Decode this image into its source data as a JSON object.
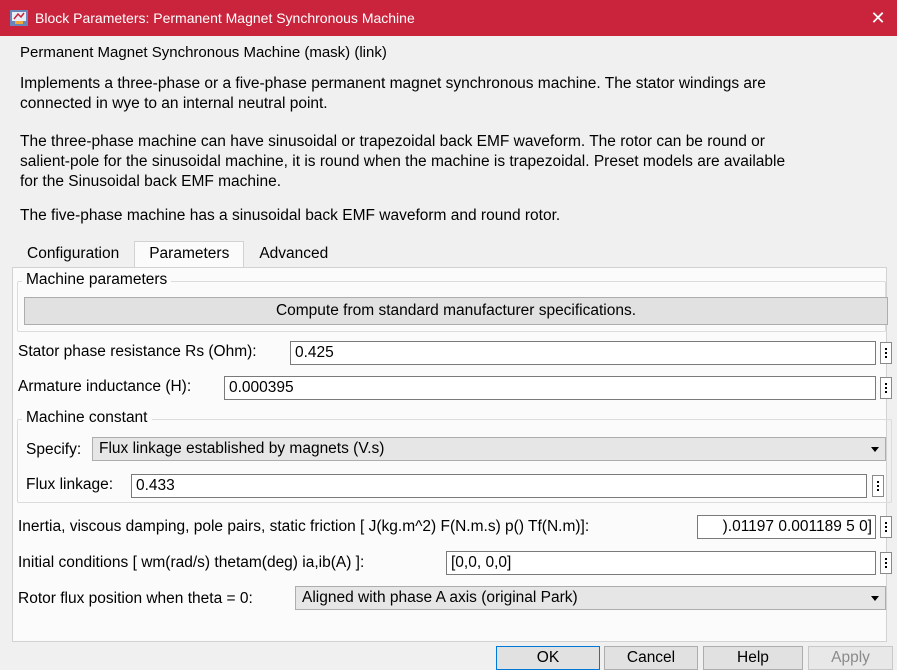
{
  "window": {
    "title": "Block Parameters: Permanent Magnet Synchronous Machine",
    "close_glyph": "✕",
    "title_bar_color": "#c9243c"
  },
  "mask_title": "Permanent Magnet Synchronous Machine (mask) (link)",
  "description": {
    "p1_line1": "Implements a three-phase or a five-phase permanent magnet synchronous machine. The stator windings are",
    "p1_line2": "connected in wye to an internal neutral point.",
    "p2_line1": "The three-phase machine can have sinusoidal or trapezoidal back EMF waveform. The rotor can be round or",
    "p2_line2": "salient-pole for the sinusoidal machine, it is round when the machine is trapezoidal. Preset models are available",
    "p2_line3": "for the Sinusoidal back EMF machine.",
    "p3_line1": "The five-phase machine has a sinusoidal back EMF waveform and round rotor."
  },
  "tabs": [
    {
      "label": "Configuration",
      "active": false
    },
    {
      "label": "Parameters",
      "active": true
    },
    {
      "label": "Advanced",
      "active": false
    }
  ],
  "machine_parameters": {
    "legend": "Machine parameters",
    "compute_button": "Compute from standard manufacturer specifications."
  },
  "params": {
    "rs_label": "Stator phase resistance Rs (Ohm):",
    "rs_value": "0.425",
    "la_label": "Armature inductance (H):",
    "la_value": "0.000395"
  },
  "machine_constant": {
    "legend": "Machine constant",
    "specify_label": "Specify:",
    "specify_value": "Flux linkage established by magnets (V.s)",
    "flux_label": "Flux linkage:",
    "flux_value": "0.433"
  },
  "mechanical": {
    "inertia_label": "Inertia, viscous damping, pole pairs, static friction [ J(kg.m^2)  F(N.m.s)  p()  Tf(N.m)]:",
    "inertia_value": ").01197 0.001189 5 0]",
    "init_label": "Initial conditions  [ wm(rad/s)  thetam(deg)  ia,ib(A) ]:",
    "init_value": "[0,0, 0,0]",
    "rotor_label": "Rotor flux position when theta = 0:",
    "rotor_value": "Aligned with phase A axis (original Park)"
  },
  "buttons": {
    "ok": "OK",
    "cancel": "Cancel",
    "help": "Help",
    "apply": "Apply"
  },
  "icons": {
    "app": "simulink-block-icon",
    "more": "ellipsis-vertical-icon",
    "dropdown": "chevron-down-icon"
  }
}
